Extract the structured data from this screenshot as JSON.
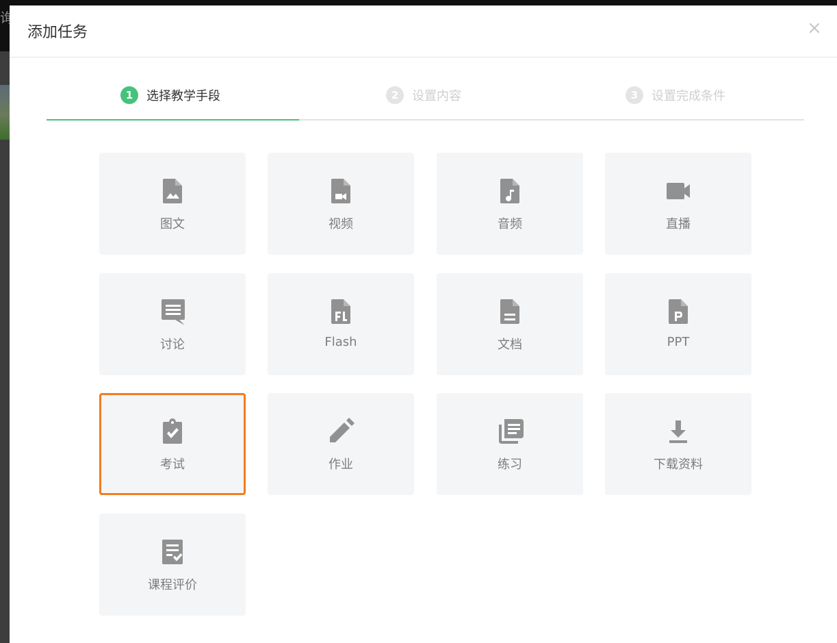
{
  "backdrop": {
    "glyph": "询"
  },
  "modal": {
    "title": "添加任务",
    "close_icon": "close-icon"
  },
  "steps": [
    {
      "num": "1",
      "label": "选择教学手段",
      "state": "active"
    },
    {
      "num": "2",
      "label": "设置内容",
      "state": "inactive"
    },
    {
      "num": "3",
      "label": "设置完成条件",
      "state": "inactive"
    }
  ],
  "colors": {
    "accent_green": "#46c37b",
    "selected_border": "#f27c1d",
    "tile_bg": "#f4f5f7",
    "icon_gray": "#919191"
  },
  "tiles": [
    {
      "label": "图文",
      "icon": "image-file-icon"
    },
    {
      "label": "视频",
      "icon": "video-file-icon"
    },
    {
      "label": "音频",
      "icon": "audio-file-icon"
    },
    {
      "label": "直播",
      "icon": "video-camera-icon"
    },
    {
      "label": "讨论",
      "icon": "comment-icon"
    },
    {
      "label": "Flash",
      "icon": "flash-file-icon"
    },
    {
      "label": "文档",
      "icon": "document-icon"
    },
    {
      "label": "PPT",
      "icon": "ppt-file-icon"
    },
    {
      "label": "考试",
      "icon": "clipboard-check-icon",
      "selected": true
    },
    {
      "label": "作业",
      "icon": "pencil-icon"
    },
    {
      "label": "练习",
      "icon": "library-books-icon"
    },
    {
      "label": "下载资料",
      "icon": "download-icon"
    },
    {
      "label": "课程评价",
      "icon": "checklist-icon"
    }
  ]
}
